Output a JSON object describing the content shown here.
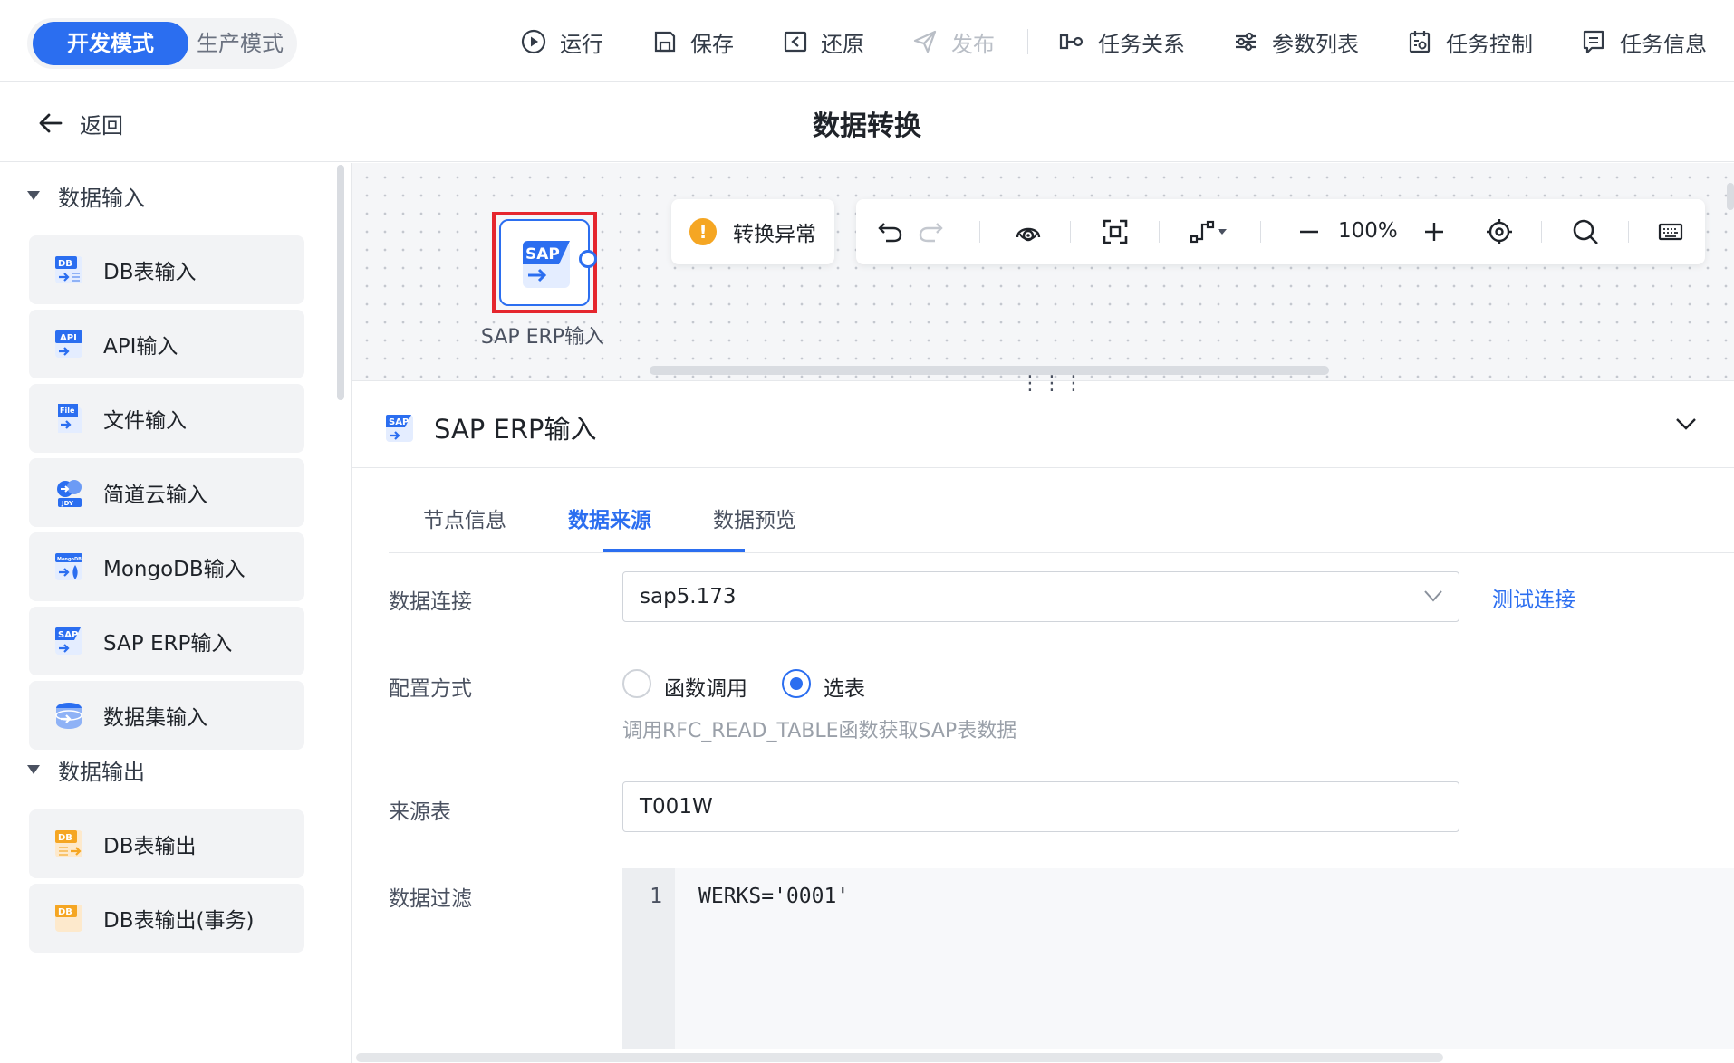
{
  "mode": {
    "dev": "开发模式",
    "prod": "生产模式"
  },
  "toolbar": {
    "run": "运行",
    "save": "保存",
    "restore": "还原",
    "publish": "发布",
    "relations": "任务关系",
    "params": "参数列表",
    "control": "任务控制",
    "info": "任务信息"
  },
  "header": {
    "back": "返回",
    "title": "数据转换"
  },
  "sidebar": {
    "input_group": "数据输入",
    "inputs": [
      {
        "label": "DB表输入",
        "icon": "db-input-icon",
        "tag": "DB"
      },
      {
        "label": "API输入",
        "icon": "api-input-icon",
        "tag": "API"
      },
      {
        "label": "文件输入",
        "icon": "file-input-icon",
        "tag": "File"
      },
      {
        "label": "简道云输入",
        "icon": "jdy-input-icon",
        "tag": "JDY"
      },
      {
        "label": "MongoDB输入",
        "icon": "mongodb-input-icon",
        "tag": "MongoDB"
      },
      {
        "label": "SAP ERP输入",
        "icon": "sap-input-icon",
        "tag": "SAP"
      },
      {
        "label": "数据集输入",
        "icon": "dataset-input-icon",
        "tag": ""
      }
    ],
    "output_group": "数据输出",
    "outputs": [
      {
        "label": "DB表输出",
        "icon": "db-output-icon",
        "tag": "DB"
      },
      {
        "label": "DB表输出(事务)",
        "icon": "db-tx-output-icon",
        "tag": "DB"
      }
    ]
  },
  "canvas": {
    "node_label": "SAP ERP输入",
    "node_icon_text": "SAP",
    "warning": "转换异常",
    "zoom": "100%"
  },
  "panel": {
    "title": "SAP ERP输入",
    "tabs": [
      "节点信息",
      "数据来源",
      "数据预览"
    ],
    "active_tab": "数据来源",
    "connection_label": "数据连接",
    "connection_value": "sap5.173",
    "test_link": "测试连接",
    "config_label": "配置方式",
    "config_options": [
      "函数调用",
      "选表"
    ],
    "config_selected": "选表",
    "config_hint": "调用RFC_READ_TABLE函数获取SAP表数据",
    "source_label": "来源表",
    "source_value": "T001W",
    "filter_label": "数据过滤",
    "filter_line_no": "1",
    "filter_code": "WERKS='0001'"
  },
  "colors": {
    "accent": "#2b6ef0",
    "warning": "#f5a623",
    "highlight": "#e5262e"
  }
}
